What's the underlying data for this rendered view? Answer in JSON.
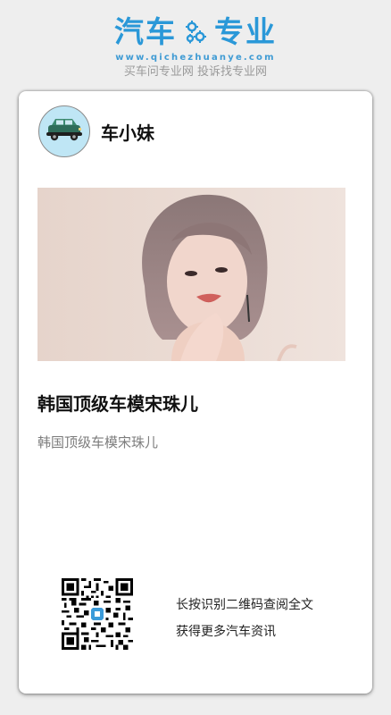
{
  "brand": {
    "title_left": "汽车",
    "title_right": "专业",
    "domain": "www.qichezhuanye.com",
    "slogan": "买车问专业网 投诉找专业网",
    "color": "#2a98d8"
  },
  "author": {
    "name": "车小妹",
    "avatar_icon": "car-avatar-icon"
  },
  "article": {
    "title": "韩国顶级车模宋珠儿",
    "summary": "韩国顶级车模宋珠儿",
    "cover_alt": "cover-photo"
  },
  "footer": {
    "qr_icon": "qr-code-icon",
    "cta_line1": "长按识别二维码查阅全文",
    "cta_line2": "获得更多汽车资讯"
  }
}
